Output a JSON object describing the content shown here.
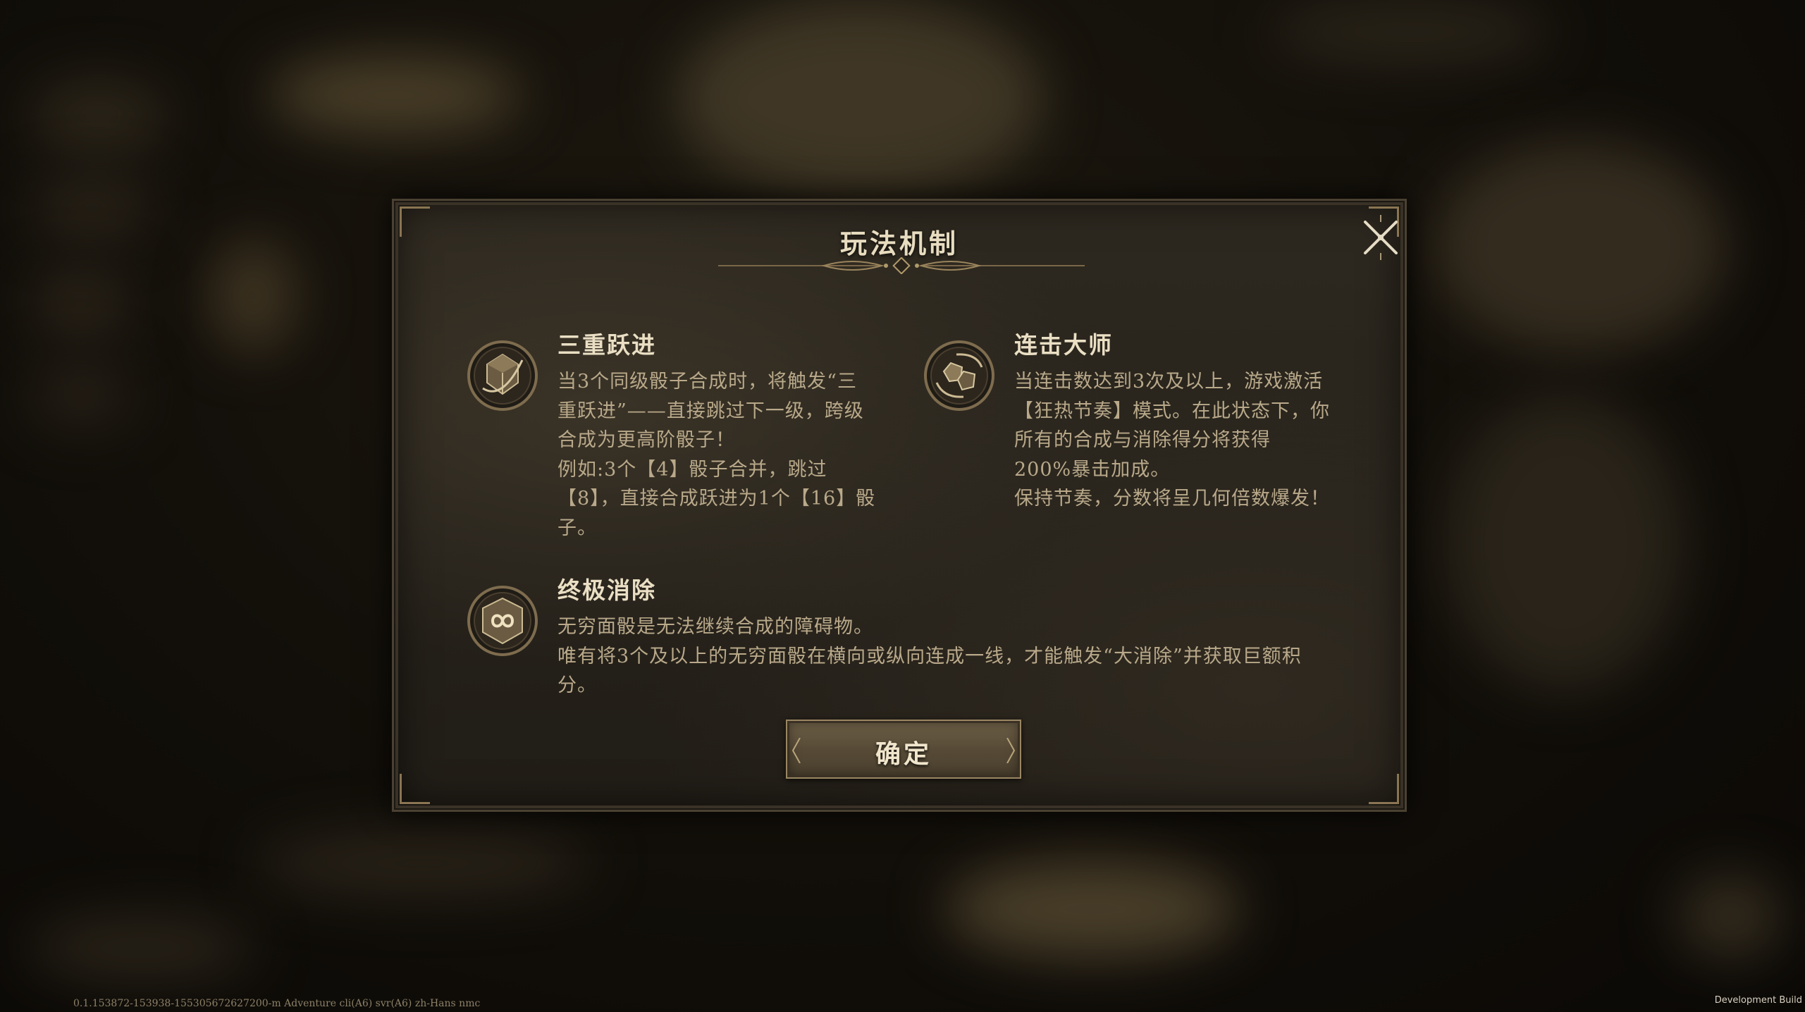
{
  "dialog": {
    "title": "玩法机制",
    "close_icon": "close-x-icon",
    "confirm_label": "确定"
  },
  "mechanics": [
    {
      "icon": "stacked-dice-icon",
      "title": "三重跃进",
      "lines": [
        "当3个同级骰子合成时，将触发“三",
        "重跃进”——直接跳过下一级，跨级",
        "合成为更高阶骰子！",
        "例如:3个【4】骰子合并，跳过",
        "【8】，直接合成跃进为1个【16】骰",
        "子。"
      ]
    },
    {
      "icon": "combo-dice-icon",
      "title": "连击大师",
      "lines": [
        "当连击数达到3次及以上，游戏激活",
        "【狂热节奏】模式。在此状态下，你",
        "所有的合成与消除得分将获得",
        "200%暴击加成。",
        "保持节奏，分数将呈几何倍数爆发！"
      ]
    },
    {
      "icon": "infinity-dice-icon",
      "title": "终极消除",
      "lines": [
        "无穷面骰是无法继续合成的障碍物。",
        "唯有将3个及以上的无穷面骰在横向或纵向连成一线，才能触发“大消除”并获取巨额积",
        "分。"
      ]
    }
  ],
  "footer": {
    "build_info": "0.1.153872-153938-1553056726272​00-m Adventure cli(A6) svr(A6) zh-Hans nmc",
    "dev_build": "Development Build"
  },
  "colors": {
    "title": "#e8dcc0",
    "body_text": "#b9a98a",
    "panel": "#26221b",
    "accent_gold": "#8a7552"
  }
}
